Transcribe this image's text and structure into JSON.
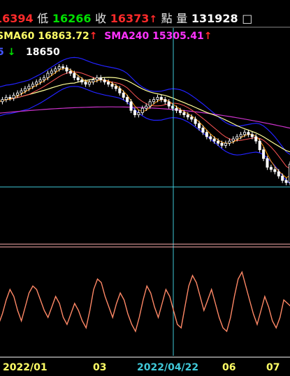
{
  "header": {
    "high_value": "16394",
    "low_label": "低",
    "low_value": "16266",
    "close_label": "收",
    "close_value": "16373",
    "close_arrow": "↑",
    "volume_label": "量",
    "volume_label_prefix": "點",
    "volume_value": "131928",
    "volume_box": "□",
    "sma60_label": "SMA60",
    "sma60_value": "16863.72",
    "sma60_arrow": "↑",
    "sma240_label": "SMA240",
    "sma240_value": "15305.41",
    "sma240_arrow": "↑",
    "row3_prefix": "5",
    "row3_arrow": "↓",
    "row3_value": "18650"
  },
  "colors": {
    "background": "#000000",
    "red": "#ff2a2a",
    "green": "#00e000",
    "white": "#ffffff",
    "yellow": "#ffff66",
    "magenta": "#ff33ff",
    "blue_band": "#2222ff",
    "cyan": "#40c8d8",
    "oscillator": "#ff8866",
    "ma_short": "#ff9900",
    "ma_mid": "#ff5555",
    "ma_long": "#ffff99",
    "ma_240": "#cc33cc",
    "separator": "#ffb0b0"
  },
  "x_axis_labels": [
    {
      "text": "2022/01",
      "color": "#ffff66"
    },
    {
      "text": "03",
      "color": "#ffff66"
    },
    {
      "text": "2022/04/22",
      "color": "#40c8d8"
    },
    {
      "text": "06",
      "color": "#ffff66"
    },
    {
      "text": "07",
      "color": "#ffff66"
    }
  ],
  "chart_data": {
    "type": "candlestick",
    "title": "",
    "xlabel": "",
    "ylabel": "",
    "x_ticks": [
      "2022/01",
      "03",
      "2022/04/22",
      "06",
      "07"
    ],
    "cursor_date": "2022/04/22",
    "price_range": [
      15850,
      18850
    ],
    "price_series_close": [
      17800,
      17850,
      17900,
      17880,
      17950,
      18000,
      18050,
      18100,
      18150,
      18200,
      18250,
      18300,
      18350,
      18450,
      18500,
      18550,
      18600,
      18580,
      18500,
      18450,
      18350,
      18300,
      18250,
      18200,
      18250,
      18300,
      18350,
      18300,
      18250,
      18200,
      18150,
      18100,
      18000,
      17900,
      17800,
      17600,
      17500,
      17550,
      17650,
      17700,
      17800,
      17850,
      17900,
      17850,
      17800,
      17700,
      17650,
      17600,
      17550,
      17500,
      17450,
      17400,
      17300,
      17200,
      17100,
      17000,
      16950,
      16900,
      16850,
      16800,
      16850,
      16900,
      16950,
      17000,
      17050,
      17100,
      17050,
      17000,
      16900,
      16700,
      16500,
      16300,
      16250,
      16200,
      16100,
      16000,
      15950,
      16373
    ],
    "legend": [
      "SMA60 16863.72",
      "SMA240 15305.41"
    ],
    "series": [
      {
        "name": "SMA60",
        "last": 16863.72
      },
      {
        "name": "SMA240",
        "last": 15305.41
      }
    ],
    "oscillator_range": [
      0,
      100
    ],
    "oscillator_values": [
      20,
      35,
      55,
      70,
      60,
      40,
      25,
      45,
      65,
      75,
      70,
      55,
      40,
      30,
      45,
      60,
      50,
      30,
      20,
      35,
      50,
      40,
      25,
      15,
      40,
      70,
      85,
      80,
      60,
      45,
      30,
      50,
      65,
      55,
      35,
      20,
      10,
      30,
      55,
      75,
      65,
      45,
      30,
      50,
      70,
      60,
      40,
      20,
      15,
      45,
      75,
      90,
      80,
      60,
      40,
      55,
      70,
      50,
      30,
      15,
      10,
      30,
      60,
      85,
      95,
      75,
      55,
      35,
      20,
      40,
      60,
      45,
      25,
      15,
      30,
      55,
      50,
      45
    ]
  }
}
